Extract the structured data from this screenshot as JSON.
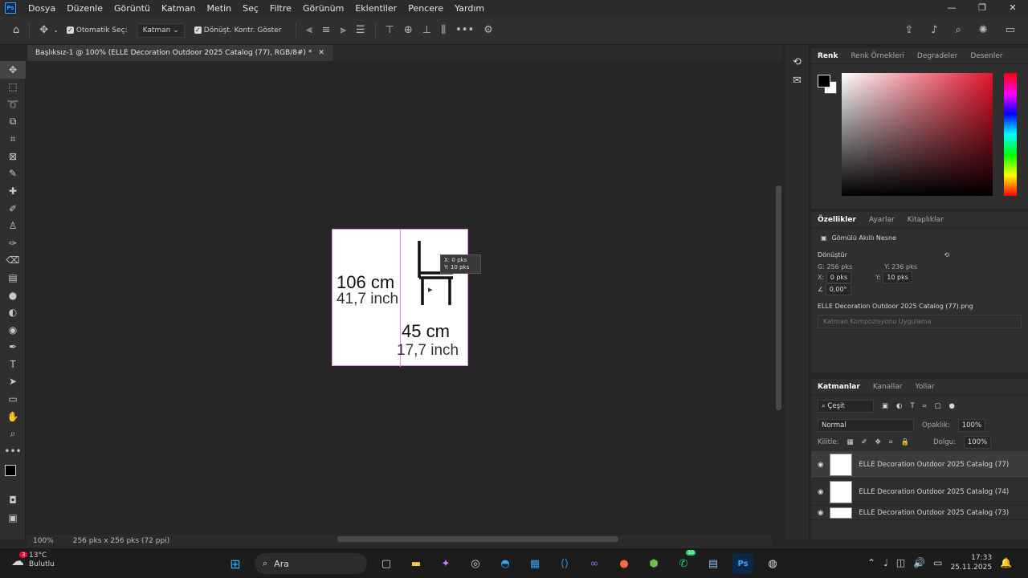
{
  "app": {
    "logo": "Ps"
  },
  "menu": [
    "Dosya",
    "Düzenle",
    "Görüntü",
    "Katman",
    "Metin",
    "Seç",
    "Filtre",
    "Görünüm",
    "Eklentiler",
    "Pencere",
    "Yardım"
  ],
  "options": {
    "auto_select": "Otomatik Seç:",
    "target": "Katman",
    "transform_controls": "Dönüşt. Kontr. Göster"
  },
  "document": {
    "tab_title": "Başlıksız-1 @ 100% (ELLE Decoration Outdoor 2025 Catalog  (77), RGB/8#) *"
  },
  "canvas": {
    "height_cm": "106 cm",
    "height_inch": "41,7 inch",
    "width_cm": "45 cm",
    "width_inch": "17,7 inch",
    "tip_x": "0 pks",
    "tip_y": "10 pks"
  },
  "status": {
    "zoom": "100%",
    "doc_info": "256 pks x 256 pks (72 ppi)"
  },
  "color_panel": {
    "tabs": [
      "Renk",
      "Renk Örnekleri",
      "Degradeler",
      "Desenler"
    ],
    "fg": "#000000",
    "bg": "#ffffff"
  },
  "props_panel": {
    "tabs": [
      "Özellikler",
      "Ayarlar",
      "Kitaplıklar"
    ],
    "type": "Gömülü Akıllı Nesne",
    "section": "Dönüştür",
    "w": "256 pks",
    "h": "236 pks",
    "x": "0 pks",
    "y": "10 pks",
    "angle": "0,00°",
    "file": "ELLE Decoration Outdoor 2025 Catalog  (77).png",
    "comp": "Katman Kompozisyonu Uygulama"
  },
  "layers_panel": {
    "tabs": [
      "Katmanlar",
      "Kanallar",
      "Yollar"
    ],
    "filter": "Çeşit",
    "blend": "Normal",
    "opacity_label": "Opaklık:",
    "opacity": "100%",
    "lock_label": "Kilitle:",
    "fill_label": "Dolgu:",
    "fill": "100%",
    "layers": [
      "ELLE Decoration Outdoor 2025 Catalog  (77)",
      "ELLE Decoration Outdoor 2025 Catalog  (74)",
      "ELLE Decoration Outdoor 2025 Catalog  (73)"
    ]
  },
  "taskbar": {
    "temp": "13°C",
    "weather": "Bulutlu",
    "badge": "3",
    "search": "Ara",
    "time": "17:33",
    "date": "25.11.2025",
    "wa_badge": "10"
  },
  "colors": {
    "accent": "#31a8ff",
    "guide": "#e58be6"
  }
}
